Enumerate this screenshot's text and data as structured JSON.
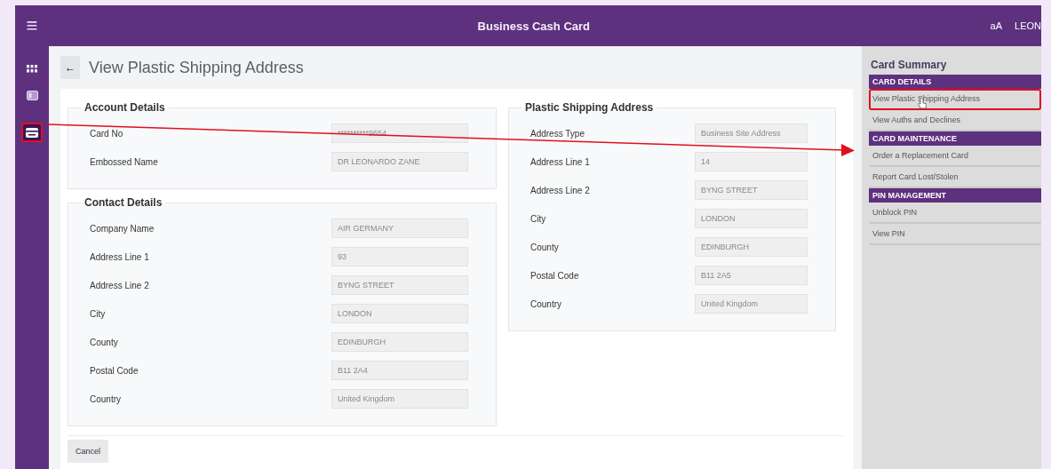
{
  "header": {
    "menu_icon": "≡",
    "title": "Business Cash Card",
    "font_toggle": "aA",
    "user": "LEON"
  },
  "rail": [
    {
      "kind": "apps",
      "selected": false
    },
    {
      "kind": "panel",
      "selected": false
    },
    {
      "kind": "card",
      "selected": true
    }
  ],
  "page": {
    "back": "←",
    "title": "View Plastic Shipping Address"
  },
  "columns": [
    [
      {
        "title": "Account Details",
        "fields": [
          {
            "label": "Card No",
            "value": "**********9654"
          },
          {
            "label": "Embossed Name",
            "value": "DR LEONARDO ZANE"
          }
        ]
      },
      {
        "title": "Contact Details",
        "fields": [
          {
            "label": "Company Name",
            "value": "AIR GERMANY"
          },
          {
            "label": "Address Line 1",
            "value": "93"
          },
          {
            "label": "Address Line 2",
            "value": "BYNG STREET"
          },
          {
            "label": "City",
            "value": "LONDON"
          },
          {
            "label": "County",
            "value": "EDINBURGH"
          },
          {
            "label": "Postal Code",
            "value": "B11 2A4"
          },
          {
            "label": "Country",
            "value": "United Kingdom"
          }
        ]
      }
    ],
    [
      {
        "title": "Plastic Shipping Address",
        "fields": [
          {
            "label": "Address Type",
            "value": "Business Site Address"
          },
          {
            "label": "Address Line 1",
            "value": "14"
          },
          {
            "label": "Address Line 2",
            "value": "BYNG STREET"
          },
          {
            "label": "City",
            "value": "LONDON"
          },
          {
            "label": "County",
            "value": "EDINBURGH"
          },
          {
            "label": "Postal Code",
            "value": "B11 2A5"
          },
          {
            "label": "Country",
            "value": "United Kingdom"
          }
        ]
      }
    ]
  ],
  "cancel": "Cancel",
  "summary": {
    "title": "Card Summary",
    "groups": [
      {
        "header": "CARD DETAILS",
        "items": [
          {
            "label": "View Plastic Shipping Address",
            "selected": true
          },
          {
            "label": "View Auths and Declines",
            "selected": false
          }
        ]
      },
      {
        "header": "CARD MAINTENANCE",
        "items": [
          {
            "label": "Order a Replacement Card",
            "selected": false
          },
          {
            "label": "Report Card Lost/Stolen",
            "selected": false
          }
        ]
      },
      {
        "header": "PIN MANAGEMENT",
        "items": [
          {
            "label": "Unblock PIN",
            "selected": false
          },
          {
            "label": "View PIN",
            "selected": false
          }
        ]
      }
    ]
  }
}
